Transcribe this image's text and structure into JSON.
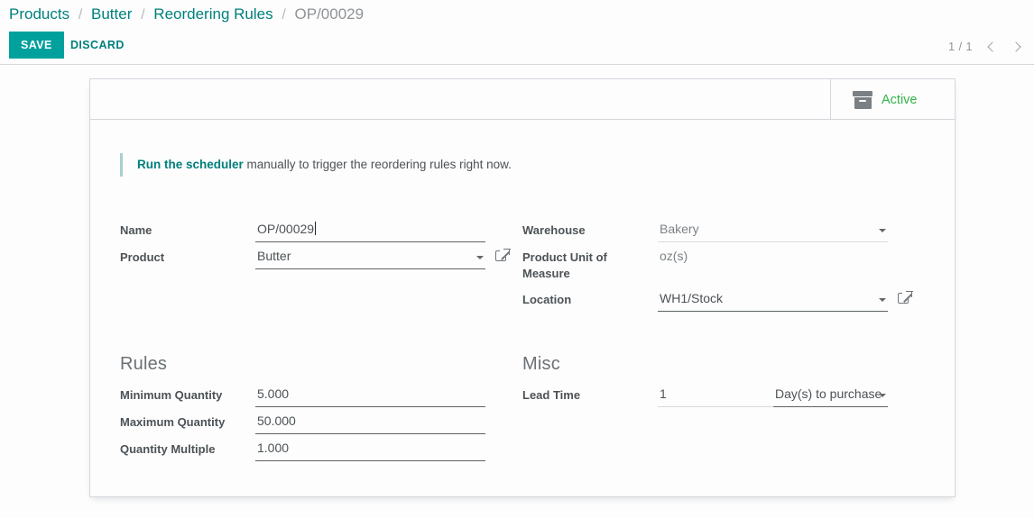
{
  "breadcrumb": {
    "items": [
      {
        "label": "Products",
        "current": false
      },
      {
        "label": "Butter",
        "current": false
      },
      {
        "label": "Reordering Rules",
        "current": false
      },
      {
        "label": "OP/00029",
        "current": true
      }
    ],
    "separator": "/"
  },
  "control_panel": {
    "save_label": "SAVE",
    "discard_label": "DISCARD",
    "pager_count": "1 / 1"
  },
  "status_button": {
    "label": "Active",
    "icon": "archive-box-icon",
    "color": "#34b44a"
  },
  "alert": {
    "link_text": "Run the scheduler",
    "rest_text": " manually to trigger the reordering rules right now."
  },
  "form": {
    "name": {
      "label": "Name",
      "value": "OP/00029"
    },
    "product": {
      "label": "Product",
      "value": "Butter",
      "has_dropdown": true,
      "has_external_link": true
    },
    "warehouse": {
      "label": "Warehouse",
      "value": "Bakery",
      "has_dropdown": true
    },
    "product_uom": {
      "label": "Product Unit of Measure",
      "value": "oz(s)"
    },
    "location": {
      "label": "Location",
      "value": "WH1/Stock",
      "has_dropdown": true,
      "has_external_link": true
    }
  },
  "rules_section": {
    "title": "Rules",
    "fields": [
      {
        "label": "Minimum Quantity",
        "value": "5.000"
      },
      {
        "label": "Maximum Quantity",
        "value": "50.000"
      },
      {
        "label": "Quantity Multiple",
        "value": "1.000"
      }
    ]
  },
  "misc_section": {
    "title": "Misc",
    "lead_time": {
      "label": "Lead Time",
      "value": "1",
      "unit": "Day(s) to purchase"
    }
  },
  "theme": {
    "accent": "#00a09d",
    "accent_dark": "#00807c",
    "active_green": "#34b44a",
    "text": "#4c5256",
    "muted": "#7d8287"
  }
}
